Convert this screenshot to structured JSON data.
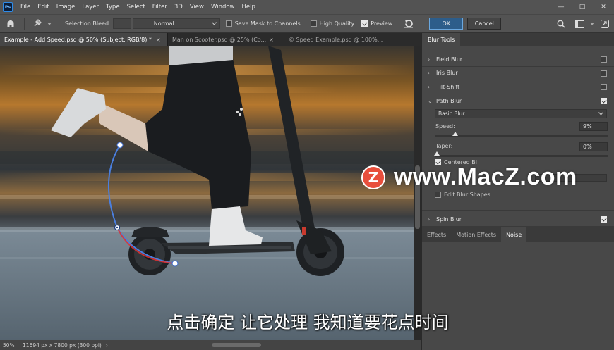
{
  "menu": {
    "app_icon": "Ps",
    "items": [
      "File",
      "Edit",
      "Image",
      "Layer",
      "Type",
      "Select",
      "Filter",
      "3D",
      "View",
      "Window",
      "Help"
    ],
    "window_controls": [
      "—",
      "□",
      "✕"
    ]
  },
  "options": {
    "selection_bleed_label": "Selection Bleed:",
    "mode_value": "Normal",
    "save_mask_label": "Save Mask to Channels",
    "high_quality_label": "High Quality",
    "preview_label": "Preview",
    "ok_label": "OK",
    "cancel_label": "Cancel",
    "save_mask_checked": false,
    "high_quality_checked": false,
    "preview_checked": true
  },
  "tabs": [
    {
      "label": "Example - Add Speed.psd @ 50% (Subject, RGB/8) *",
      "close": "×"
    },
    {
      "label": "Man on Scooter.psd @ 25% (Co...",
      "close": "×"
    },
    {
      "label": "© Speed Example.psd @ 100%...",
      "close": "×"
    }
  ],
  "status": {
    "zoom": "50%",
    "dimensions": "11694 px x 7800 px (300 ppi)",
    "arrow": "›"
  },
  "panel": {
    "title": "Blur Tools",
    "field_blur": "Field Blur",
    "iris_blur": "Iris Blur",
    "tilt_shift": "Tilt-Shift",
    "path_blur": "Path Blur",
    "path_blur_mode": "Basic Blur",
    "speed_label": "Speed:",
    "speed_value": "9%",
    "speed_level": 0.09,
    "taper_label": "Taper:",
    "taper_value": "0%",
    "taper_level": 0.0,
    "centered_blur": "Centered Bl",
    "edit_blur_shapes": "Edit Blur Shapes",
    "spin_blur": "Spin Blur",
    "field_checked": false,
    "iris_checked": false,
    "tilt_checked": false,
    "path_checked": true,
    "spin_checked": true,
    "centered_checked": true,
    "edit_shapes_checked": false
  },
  "effects_tabs": [
    "Effects",
    "Motion Effects",
    "Noise"
  ],
  "watermark": {
    "logo": "Z",
    "text": "www.MacZ.com"
  },
  "subtitle": "点击确定 让它处理 我知道要花点时间",
  "colors": {
    "accent": "#2d5d8a",
    "watermark_red": "#e84f3c",
    "path_blue": "#4a7fe0"
  }
}
